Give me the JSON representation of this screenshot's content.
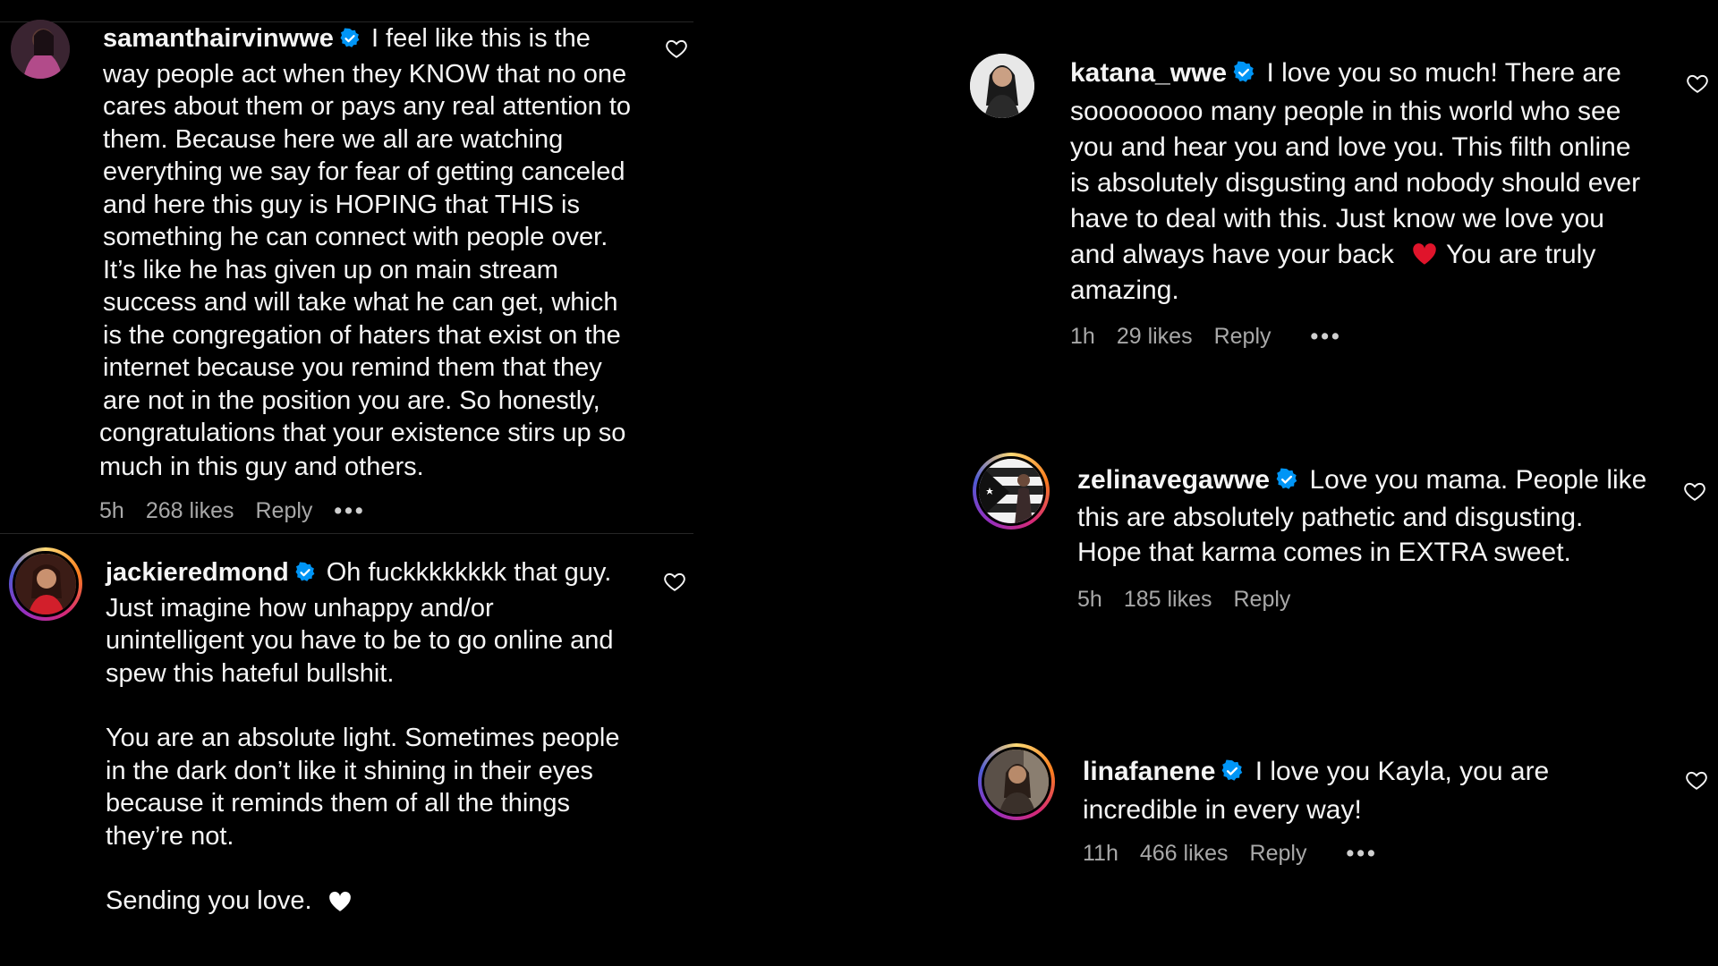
{
  "comments": [
    {
      "username": "samanthairvinwwe",
      "text": "I feel like this is the way people act when they KNOW that no one cares about them or pays any real attention to them. Because here we all are watching everything we say for fear of getting canceled and here this guy is HOPING that THIS is something he can connect with people over. It’s like he has given up on main stream success and will take what he can get, which is the congregation of haters that exist on the internet because you remind them that they are not in the position you are. So honestly,",
      "text_continued": "congratulations that your existence stirs up so much in this guy and others.",
      "time": "5h",
      "likes": "268 likes",
      "reply": "Reply",
      "more": "•••"
    },
    {
      "username": "jackieredmond",
      "text": "Oh fuckkkkkkkk that guy. Just imagine how unhappy and/or unintelligent you have to be to go online and spew this hateful bullshit.",
      "paragraph2": "You are an absolute light. Sometimes people in the dark don’t like it shining in their eyes because it reminds them of all the things they’re not.",
      "paragraph3": "Sending you love.",
      "emoji": "🤍"
    },
    {
      "username": "katana_wwe",
      "text": "I love you so much! There are soooooooo many people in this world who see you and hear you and love you. This filth online is absolutely disgusting and nobody should ever have to deal with this. Just know we love you and always have your back",
      "emoji": "❤️",
      "text_end": "You are truly amazing.",
      "time": "1h",
      "likes": "29 likes",
      "reply": "Reply",
      "more": "•••"
    },
    {
      "username": "zelinavegawwe",
      "text": "Love you mama. People like this are absolutely pathetic and disgusting. Hope that karma comes in EXTRA sweet.",
      "time": "5h",
      "likes": "185 likes",
      "reply": "Reply"
    },
    {
      "username": "linafanene",
      "text": "I love you Kayla, you are incredible in every way!",
      "time": "11h",
      "likes": "466 likes",
      "reply": "Reply",
      "more": "•••"
    }
  ],
  "colors": {
    "background": "#000000",
    "text": "#f5f5f5",
    "meta": "#a8a8a8",
    "verified": "#0095f6",
    "divider": "#262626"
  },
  "icons": {
    "verified": "verified-badge-icon",
    "like": "heart-outline-icon"
  }
}
